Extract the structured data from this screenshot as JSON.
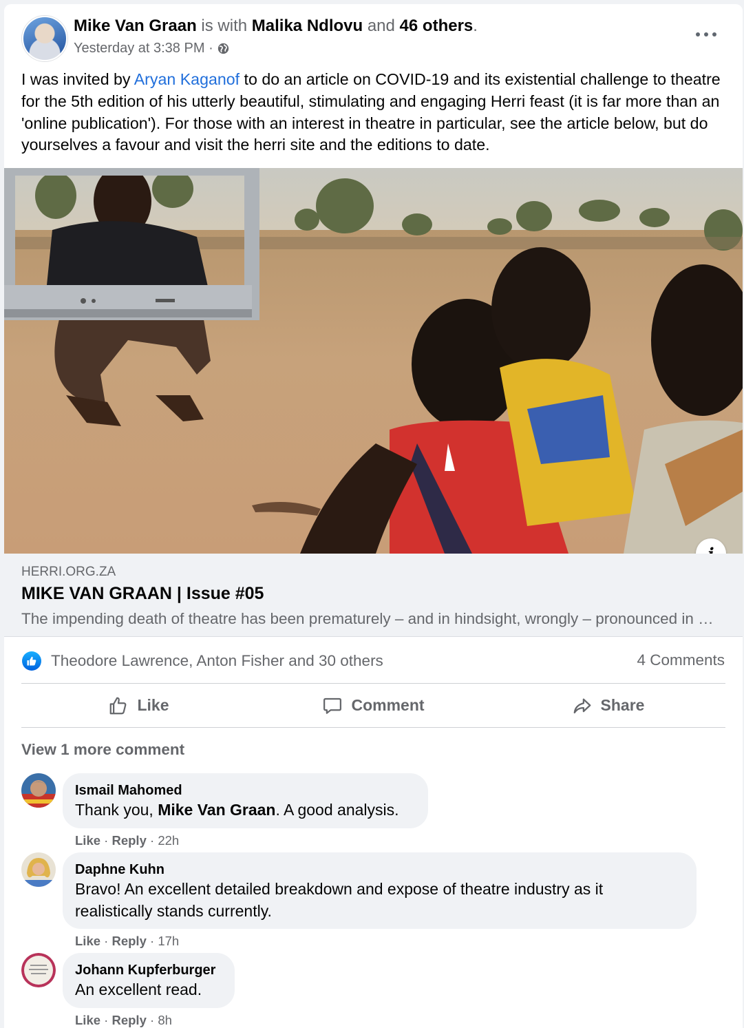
{
  "post": {
    "author": "Mike Van Graan",
    "with_text": "is with",
    "tagged": "Malika Ndlovu",
    "and_text": "and",
    "others": "46 others",
    "period": ".",
    "timestamp": "Yesterday at 3:38 PM",
    "separator": "·",
    "privacy_icon": "globe-icon",
    "text_before_mention": "I was invited by ",
    "mention": "Aryan Kaganof",
    "text_after_mention": " to do an article on COVID-19 and its existential challenge to theatre for the 5th edition of his utterly beautiful, stimulating and engaging Herri feast (it is far more than an 'online publication').  For those with an interest in theatre in particular, see the article below, but do yourselves a favour and visit   the herri site and the editions to date."
  },
  "link_preview": {
    "domain": "HERRI.ORG.ZA",
    "title": "MIKE VAN GRAAN | Issue #05",
    "description": "The impending death of theatre has been prematurely – and in hindsight, wrongly – pronounced in the past. Theatre has survived many threats before."
  },
  "reactions": {
    "summary": "Theodore Lawrence, Anton Fisher and 30 others",
    "comments_count": "4 Comments"
  },
  "actions": {
    "like": "Like",
    "comment": "Comment",
    "share": "Share"
  },
  "view_more": "View 1 more comment",
  "comments": [
    {
      "author": "Ismail Mahomed",
      "text_before": "Thank you, ",
      "mention": "Mike Van Graan",
      "text_after": ". A good analysis.",
      "like": "Like",
      "reply": "Reply",
      "dot": "·",
      "time": "22h"
    },
    {
      "author": "Daphne Kuhn",
      "text": "Bravo! An excellent detailed breakdown and expose of theatre industry as it realistically stands currently.",
      "like": "Like",
      "reply": "Reply",
      "dot": "·",
      "time": "17h"
    },
    {
      "author": "Johann Kupferburger",
      "text": "An excellent read.",
      "like": "Like",
      "reply": "Reply",
      "dot": "·",
      "time": "8h"
    }
  ],
  "colors": {
    "link_blue": "#216fdb",
    "secondary_text": "#65676b",
    "like_blue": "#1877f2"
  }
}
